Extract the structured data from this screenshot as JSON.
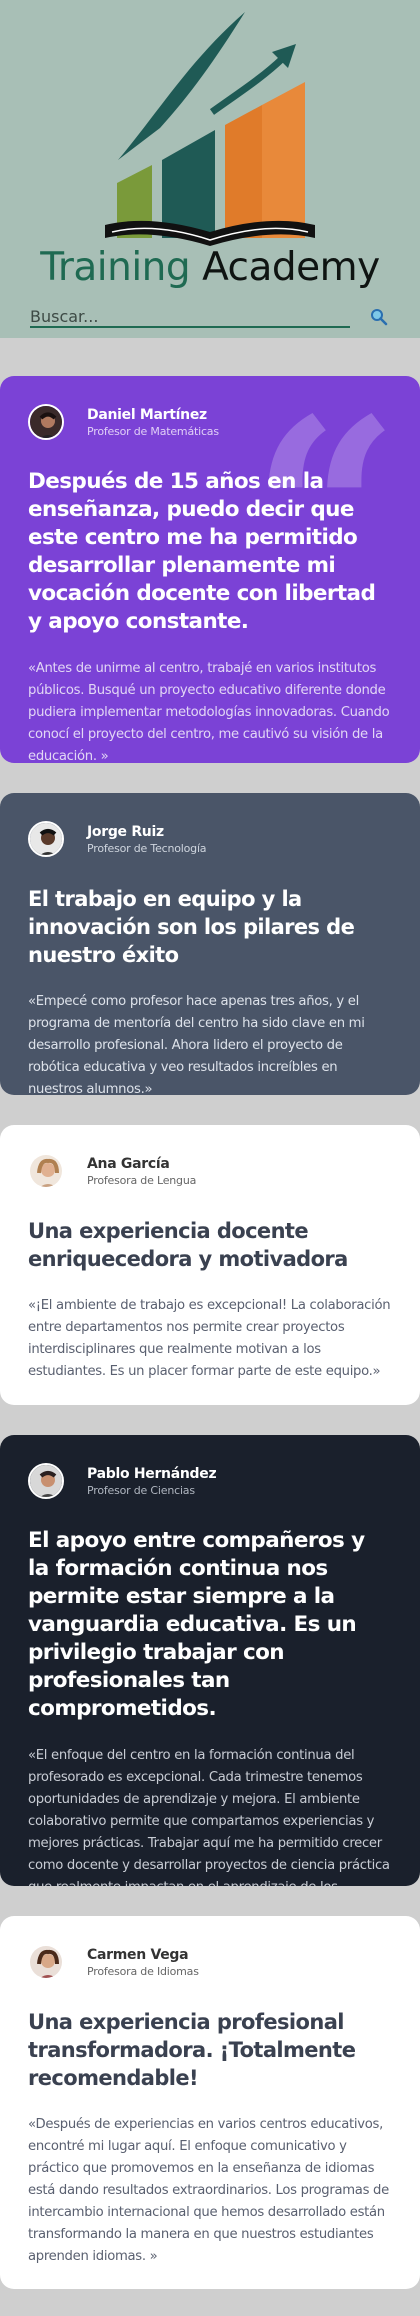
{
  "brand": {
    "word1": "Training",
    "word2": "Academy",
    "logo_icon": "growth-chart-book-logo",
    "colors": {
      "green": "#1f6a52",
      "orange": "#e07b2a",
      "olive": "#7a9a3a",
      "teal": "#1f5a55"
    }
  },
  "search": {
    "placeholder": "Buscar...",
    "icon": "search-icon"
  },
  "testimonials": [
    {
      "name": "Daniel Martínez",
      "role": "Profesor de Matemáticas",
      "headline": "Después de 15 años en la enseñanza, puedo decir que este centro me ha permitido desarrollar plenamente mi vocación docente con libertad y apoyo constante.",
      "quote": "«Antes de unirme al centro, trabajé en varios institutos públicos. Busqué un proyecto educativo diferente donde pudiera implementar metodologías innovadoras. Cuando conocí el proyecto del centro, me cautivó su visión de la educación. »",
      "background": "#7b42d6",
      "decoration": "“"
    },
    {
      "name": "Jorge Ruiz",
      "role": "Profesor de Tecnología",
      "headline": "El trabajo en equipo y la innovación son los pilares de nuestro éxito",
      "quote": "«Empecé como profesor hace apenas tres años, y el programa de mentoría del centro ha sido clave en mi desarrollo profesional. Ahora lidero el proyecto de robótica educativa y veo resultados increíbles en nuestros alumnos.»",
      "background": "#4a5568"
    },
    {
      "name": "Ana García",
      "role": "Profesora de Lengua",
      "headline": "Una experiencia docente enriquecedora y motivadora",
      "quote": "«¡El ambiente de trabajo es excepcional! La colaboración entre departamentos nos permite crear proyectos interdisciplinares que realmente motivan a los estudiantes. Es un placer formar parte de este equipo.»",
      "background": "#ffffff"
    },
    {
      "name": "Pablo Hernández",
      "role": "Profesor de Ciencias",
      "headline": "El apoyo entre compañeros y la formación continua nos permite estar siempre a la vanguardia educativa. Es un privilegio trabajar con profesionales tan comprometidos.",
      "quote": "«El enfoque del centro en la formación continua del profesorado es excepcional. Cada trimestre tenemos oportunidades de aprendizaje y mejora. El ambiente colaborativo permite que compartamos experiencias y mejores prácticas. Trabajar aquí me ha permitido crecer como docente y desarrollar proyectos de ciencia práctica que realmente impactan en el aprendizaje de los estudiantes.»",
      "background": "#1a202c"
    },
    {
      "name": "Carmen Vega",
      "role": "Profesora de Idiomas",
      "headline": "Una experiencia profesional transformadora. ¡Totalmente recomendable!",
      "quote": "«Después de experiencias en varios centros educativos, encontré mi lugar aquí. El enfoque comunicativo y práctico que promovemos en la enseñanza de idiomas está dando resultados extraordinarios. Los programas de intercambio internacional que hemos desarrollado están transformando la manera en que nuestros estudiantes aprenden idiomas. »",
      "background": "#ffffff"
    }
  ]
}
